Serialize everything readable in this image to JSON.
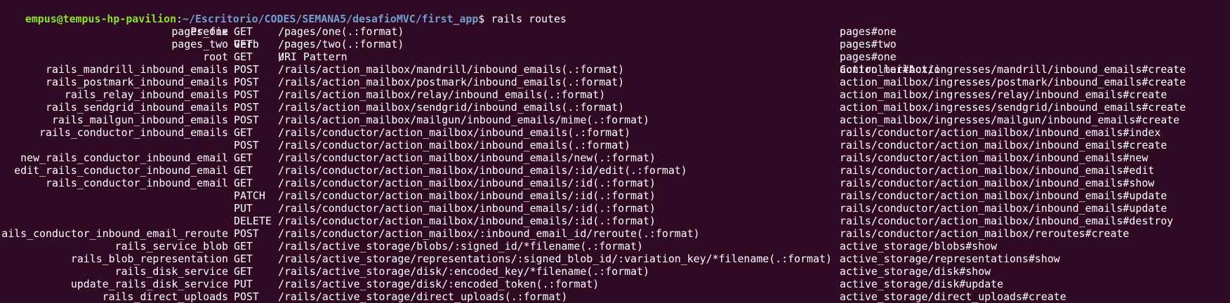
{
  "prompt": {
    "user_host": "empus@tempus-hp-pavilion",
    "separator": ":",
    "path": "~/Escritorio/CODES/SEMANA5/desafioMVC/first_app",
    "symbol": "$",
    "command": "rails routes"
  },
  "headers": {
    "prefix": "Prefix",
    "verb": "Verb",
    "uri": "URI Pattern",
    "action": "Controller#Action"
  },
  "routes": [
    {
      "prefix": "pages_one",
      "verb": "GET",
      "uri": "/pages/one(.:format)",
      "action": "pages#one"
    },
    {
      "prefix": "pages_two",
      "verb": "GET",
      "uri": "/pages/two(.:format)",
      "action": "pages#two"
    },
    {
      "prefix": "root",
      "verb": "GET",
      "uri": "/",
      "action": "pages#one"
    },
    {
      "prefix": "rails_mandrill_inbound_emails",
      "verb": "POST",
      "uri": "/rails/action_mailbox/mandrill/inbound_emails(.:format)",
      "action": "action_mailbox/ingresses/mandrill/inbound_emails#create"
    },
    {
      "prefix": "rails_postmark_inbound_emails",
      "verb": "POST",
      "uri": "/rails/action_mailbox/postmark/inbound_emails(.:format)",
      "action": "action_mailbox/ingresses/postmark/inbound_emails#create"
    },
    {
      "prefix": "rails_relay_inbound_emails",
      "verb": "POST",
      "uri": "/rails/action_mailbox/relay/inbound_emails(.:format)",
      "action": "action_mailbox/ingresses/relay/inbound_emails#create"
    },
    {
      "prefix": "rails_sendgrid_inbound_emails",
      "verb": "POST",
      "uri": "/rails/action_mailbox/sendgrid/inbound_emails(.:format)",
      "action": "action_mailbox/ingresses/sendgrid/inbound_emails#create"
    },
    {
      "prefix": "rails_mailgun_inbound_emails",
      "verb": "POST",
      "uri": "/rails/action_mailbox/mailgun/inbound_emails/mime(.:format)",
      "action": "action_mailbox/ingresses/mailgun/inbound_emails#create"
    },
    {
      "prefix": "rails_conductor_inbound_emails",
      "verb": "GET",
      "uri": "/rails/conductor/action_mailbox/inbound_emails(.:format)",
      "action": "rails/conductor/action_mailbox/inbound_emails#index"
    },
    {
      "prefix": "",
      "verb": "POST",
      "uri": "/rails/conductor/action_mailbox/inbound_emails(.:format)",
      "action": "rails/conductor/action_mailbox/inbound_emails#create"
    },
    {
      "prefix": "new_rails_conductor_inbound_email",
      "verb": "GET",
      "uri": "/rails/conductor/action_mailbox/inbound_emails/new(.:format)",
      "action": "rails/conductor/action_mailbox/inbound_emails#new"
    },
    {
      "prefix": "edit_rails_conductor_inbound_email",
      "verb": "GET",
      "uri": "/rails/conductor/action_mailbox/inbound_emails/:id/edit(.:format)",
      "action": "rails/conductor/action_mailbox/inbound_emails#edit"
    },
    {
      "prefix": "rails_conductor_inbound_email",
      "verb": "GET",
      "uri": "/rails/conductor/action_mailbox/inbound_emails/:id(.:format)",
      "action": "rails/conductor/action_mailbox/inbound_emails#show"
    },
    {
      "prefix": "",
      "verb": "PATCH",
      "uri": "/rails/conductor/action_mailbox/inbound_emails/:id(.:format)",
      "action": "rails/conductor/action_mailbox/inbound_emails#update"
    },
    {
      "prefix": "",
      "verb": "PUT",
      "uri": "/rails/conductor/action_mailbox/inbound_emails/:id(.:format)",
      "action": "rails/conductor/action_mailbox/inbound_emails#update"
    },
    {
      "prefix": "",
      "verb": "DELETE",
      "uri": "/rails/conductor/action_mailbox/inbound_emails/:id(.:format)",
      "action": "rails/conductor/action_mailbox/inbound_emails#destroy"
    },
    {
      "prefix": "ails_conductor_inbound_email_reroute",
      "verb": "POST",
      "uri": "/rails/conductor/action_mailbox/:inbound_email_id/reroute(.:format)",
      "action": "rails/conductor/action_mailbox/reroutes#create"
    },
    {
      "prefix": "rails_service_blob",
      "verb": "GET",
      "uri": "/rails/active_storage/blobs/:signed_id/*filename(.:format)",
      "action": "active_storage/blobs#show"
    },
    {
      "prefix": "rails_blob_representation",
      "verb": "GET",
      "uri": "/rails/active_storage/representations/:signed_blob_id/:variation_key/*filename(.:format)",
      "action": "active_storage/representations#show"
    },
    {
      "prefix": "rails_disk_service",
      "verb": "GET",
      "uri": "/rails/active_storage/disk/:encoded_key/*filename(.:format)",
      "action": "active_storage/disk#show"
    },
    {
      "prefix": "update_rails_disk_service",
      "verb": "PUT",
      "uri": "/rails/active_storage/disk/:encoded_token(.:format)",
      "action": "active_storage/disk#update"
    },
    {
      "prefix": "rails_direct_uploads",
      "verb": "POST",
      "uri": "/rails/active_storage/direct_uploads(.:format)",
      "action": "active_storage/direct_uploads#create"
    }
  ],
  "colors": {
    "background": "#300a24",
    "prompt_user": "#8ae234",
    "prompt_path": "#729fcf",
    "text": "#ffffff"
  }
}
